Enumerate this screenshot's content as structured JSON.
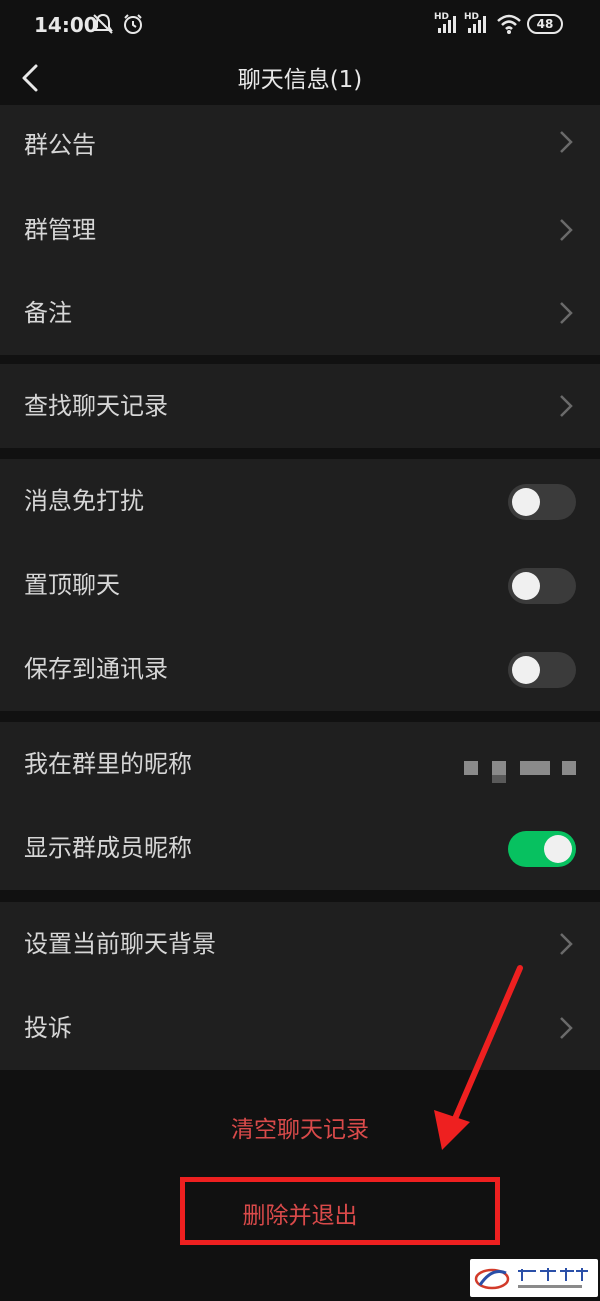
{
  "status_bar": {
    "time": "14:00",
    "network_1": "HD",
    "network_2": "HD",
    "battery": "48"
  },
  "header": {
    "title": "聊天信息(1)"
  },
  "groups": {
    "group_info": {
      "announcement": "群公告",
      "manage": "群管理",
      "remark": "备注"
    },
    "search": {
      "find_history": "查找聊天记录"
    },
    "settings": {
      "mute": "消息免打扰",
      "mute_on": false,
      "sticky": "置顶聊天",
      "sticky_on": false,
      "save_contacts": "保存到通讯录",
      "save_contacts_on": false
    },
    "nickname": {
      "my_nickname": "我在群里的昵称",
      "show_nicknames": "显示群成员昵称",
      "show_nicknames_on": true
    },
    "background": {
      "set_background": "设置当前聊天背景",
      "complain": "投诉"
    }
  },
  "actions": {
    "clear_history": "清空聊天记录",
    "delete_exit": "删除并退出"
  },
  "colors": {
    "background": "#111111",
    "group_bg": "#1f1f1f",
    "toggle_on": "#07c160",
    "danger_text": "#d94a4a",
    "annotation": "#ee2020"
  }
}
